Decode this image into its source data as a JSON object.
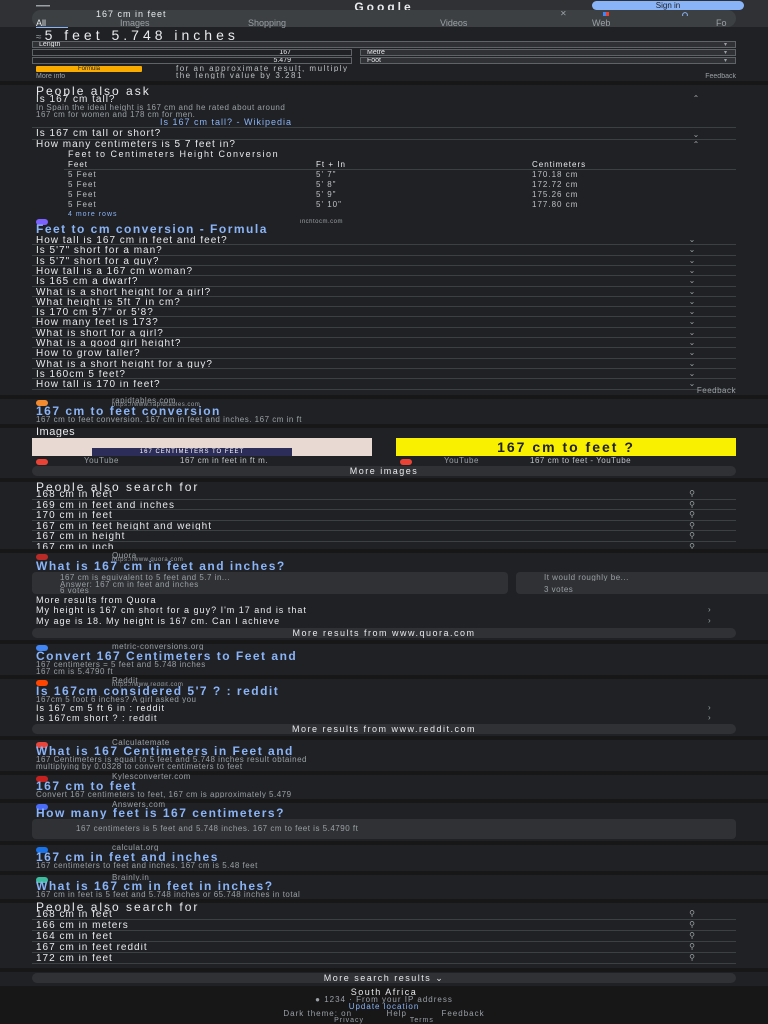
{
  "header": {
    "logo": "Google",
    "sign_in": "Sign in",
    "search_query": "167 cm in feet",
    "tabs": [
      "All",
      "Images",
      "Shopping",
      "Videos",
      "Web",
      "Fo"
    ]
  },
  "converter": {
    "result_prefix": "≈",
    "result": "5 feet 5.748 inches",
    "unit_category": "Length",
    "from_value": "167",
    "from_unit": "Metre",
    "to_value": "5.479",
    "to_unit": "Foot",
    "formula_label": "Formula",
    "formula_text": "for an approximate result, multiply",
    "formula_text2": "the length value by 3.281",
    "more_info": "More info",
    "feedback": "Feedback"
  },
  "paa": {
    "heading": "People also ask",
    "q1": "Is 167 cm tall?",
    "a1_line1": "In Spain the ideal height is 167 cm and he rated about around",
    "a1_line2": "167 cm for women and 178 cm for men.",
    "a1_source": "Is 167 cm tall? - Wikipedia",
    "q2": "Is 167 cm tall or short?",
    "q3": "How many centimeters is 5 7 feet in?",
    "table_title": "Feet to Centimeters Height Conversion",
    "table_headers": [
      "Feet",
      "Ft + In",
      "Centimeters"
    ],
    "table_rows": [
      [
        "5 Feet",
        "5' 7\"",
        "170.18 cm"
      ],
      [
        "5 Feet",
        "5' 8\"",
        "172.72 cm"
      ],
      [
        "5 Feet",
        "5' 9\"",
        "175.26 cm"
      ],
      [
        "5 Feet",
        "5' 10\"",
        "177.80 cm"
      ]
    ],
    "more_rows": "4 more rows",
    "table_source_site": "inchtocm.com",
    "table_source_title": "Feet to cm conversion - Formula",
    "questions": [
      "How tall is 167 cm in feet and feet?",
      "Is 5'7\" short for a man?",
      "Is 5'7\" short for a guy?",
      "How tall is a 167 cm woman?",
      "Is 165 cm a dwarf?",
      "What is a short height for a girl?",
      "What height is 5ft 7 in cm?",
      "Is 170 cm 5'7\" or 5'8?",
      "How many feet is 173?",
      "What is short for a girl?",
      "What is a good girl height?",
      "How to grow taller?",
      "What is a short height for a guy?",
      "Is 160cm 5 feet?",
      "How tall is 170 in feet?"
    ],
    "feedback": "Feedback"
  },
  "result1": {
    "site": "rapidtables.com",
    "url": "https://www.rapidtables.com",
    "title": "167 cm to feet conversion",
    "snippet": "167 cm to feet conversion. 167 cm in feet and inches. 167 cm in ft"
  },
  "images": {
    "heading": "Images",
    "img1_text": "167 CENTIMETERS TO FEET",
    "img1_caption": "167 cm in feet in ft m.",
    "img1_source": "YouTube",
    "img2_text": "167 cm to feet ?",
    "img2_caption": "167 cm to feet - YouTube",
    "img2_source": "YouTube",
    "more": "More images"
  },
  "pase1": {
    "heading": "People also search for",
    "items": [
      "168 cm in feet",
      "169 cm in feet and inches",
      "170 cm in feet",
      "167 cm in feet height and weight",
      "167 cm in height",
      "167 cm in inch"
    ]
  },
  "quora": {
    "site": "Quora",
    "url": "https://www.quora.com",
    "title": "What is 167 cm in feet and inches?",
    "answer1_line1": "167 cm is equivalent to 5 feet and 5.7 in...",
    "answer1_line2": "Answer: 167 cm in feet and inches",
    "answer1_votes": "6 votes",
    "answer2_line1": "It would roughly be...",
    "answer2_votes": "3 votes",
    "more_q_heading": "More results from Quora",
    "mq1": "My height is 167 cm short for a guy? I'm 17 and is that",
    "mq2": "My age is 18. My height is 167 cm. Can I achieve",
    "more_results": "More results from www.quora.com"
  },
  "result2": {
    "site": "metric-conversions.org",
    "title": "Convert 167 Centimeters to Feet and",
    "snippet1": "167 centimeters = 5 feet and 5.748 inches",
    "snippet2": "167 cm is 5.4790 ft"
  },
  "reddit": {
    "site": "Reddit",
    "url": "https://www.reddit.com",
    "title": "Is 167cm considered 5'7 ? : reddit",
    "snippet": "167cm 5 foot 6 inches? A girl asked you",
    "q1": "Is 167 cm 5 ft 6 in : reddit",
    "q2": "Is 167cm short ? : reddit",
    "more_results": "More results from www.reddit.com"
  },
  "result3": {
    "site": "Calculatemate",
    "title": "What is 167 Centimeters in Feet and",
    "snippet1": "167 Centimeters is equal to 5 feet and 5.748 inches result obtained",
    "snippet2": "multiplying by 0.0328 to convert centimeters to feet"
  },
  "result4": {
    "site": "Kylesconverter.com",
    "title": "167 cm to feet",
    "snippet": "Convert 167 centimeters to feet, 167 cm is approximately 5.479"
  },
  "result5": {
    "site": "Answers.com",
    "title": "How many feet is 167 centimeters?",
    "snippet": "167 centimeters is 5 feet and 5.748 inches. 167 cm to feet is 5.4790 ft"
  },
  "result6": {
    "site": "calculat.org",
    "title": "167 cm in feet and inches",
    "snippet": "167 centimeters to feet and inches. 167 cm is 5.48 feet"
  },
  "result7": {
    "site": "Brainly.in",
    "title": "What is 167 cm in feet in inches?",
    "snippet": "167 cm in feet is 5 feet and 5.748 inches or 65.748 inches in total"
  },
  "pase2": {
    "heading": "People also search for",
    "items": [
      "168 cm in feet",
      "166 cm in meters",
      "164 cm in feet",
      "167 cm in feet reddit",
      "172 cm in feet"
    ]
  },
  "footer": {
    "more_results": "More search results",
    "location": "South Africa",
    "location_detail": "1234 · From your IP address",
    "update": "Update location",
    "links": [
      "Dark theme: on",
      "Help",
      "Feedback"
    ],
    "privacy": "Privacy",
    "terms": "Terms"
  },
  "colors": {
    "background": "#202124",
    "surface": "#303134",
    "link": "#8ab4f8",
    "text": "#e8eaed",
    "secondary": "#9aa0a6",
    "accent_yellow": "#f9f000"
  }
}
